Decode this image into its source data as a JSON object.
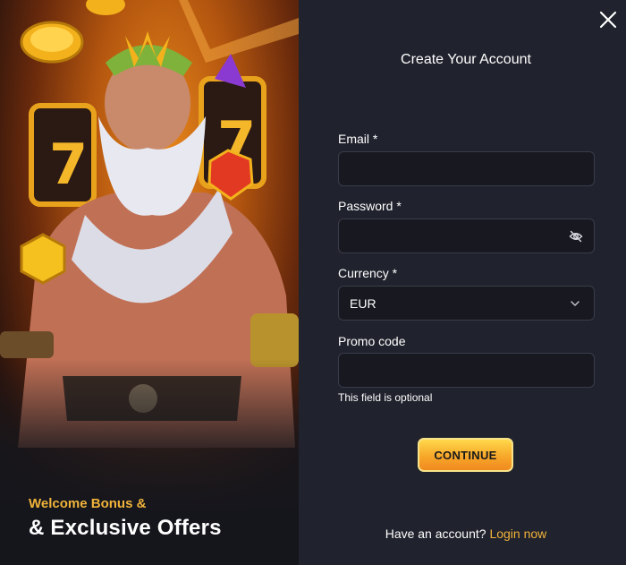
{
  "promo": {
    "subtitle": "Welcome Bonus &",
    "title": "& Exclusive Offers"
  },
  "form": {
    "title": "Create Your Account",
    "email": {
      "label": "Email *",
      "value": "",
      "placeholder": ""
    },
    "password": {
      "label": "Password *",
      "value": "",
      "placeholder": "",
      "toggle_icon": "eye-off-icon"
    },
    "currency": {
      "label": "Currency *",
      "selected": "EUR",
      "icon": "chevron-down-icon"
    },
    "promo_code": {
      "label": "Promo code",
      "value": "",
      "placeholder": "",
      "hint": "This field is optional"
    },
    "continue_label": "CONTINUE",
    "footer_text": "Have an account?",
    "login_link": "Login now"
  },
  "colors": {
    "accent": "#f0b33a",
    "panel_bg": "#20222d",
    "field_bg": "#171820",
    "button_gradient_top": "#ffd84a",
    "button_gradient_bottom": "#f08a1f"
  },
  "icons": {
    "close": "close-icon"
  }
}
